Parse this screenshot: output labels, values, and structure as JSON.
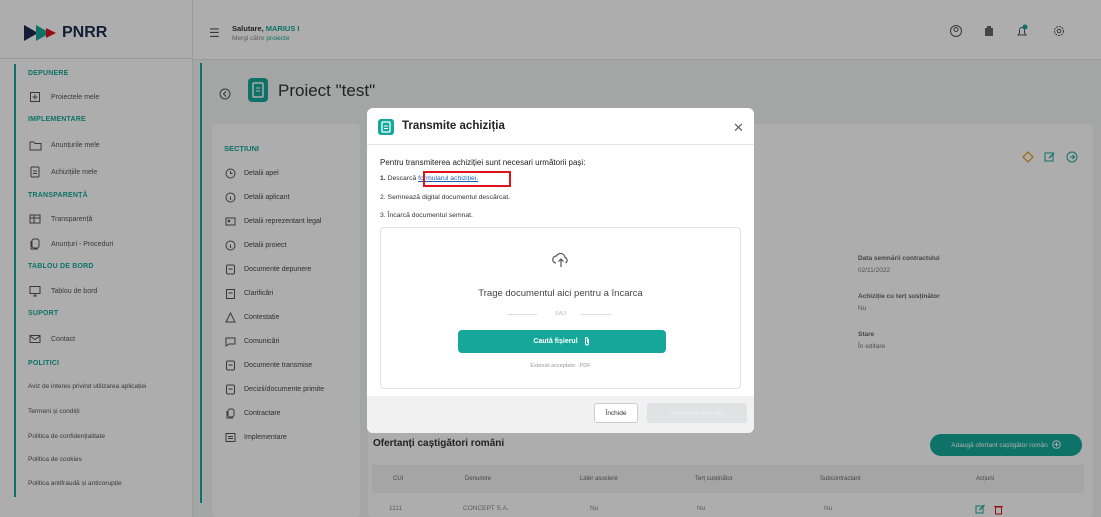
{
  "header": {
    "greeting_prefix": "Salutare, ",
    "user": "MARIUS I",
    "projects_prefix": "Mergi către ",
    "projects_link": "proiecte"
  },
  "logo": {
    "text": "PNRR"
  },
  "sidebar": {
    "sections": [
      "DEPUNERE",
      "IMPLEMENTARE",
      "TRANSPARENȚĂ",
      "TABLOU DE BORD",
      "SUPORT",
      "POLITICI"
    ],
    "items": [
      "Proiectele mele",
      "Anunțurile mele",
      "Achizițiile mele",
      "Transparență",
      "Anunțuri - Proceduri",
      "Tablou de bord",
      "Contact"
    ],
    "policies": [
      "Aviz de interes privind utilizarea aplicației",
      "Termeni și condiții",
      "Politica de confidențialitate",
      "Politica de cookies",
      "Politica antifraudă și anticorupție"
    ]
  },
  "project": {
    "title": "Proiect \"test\""
  },
  "sections_panel": {
    "title": "SECȚIUNI",
    "items": [
      "Detalii apel",
      "Detalii aplicant",
      "Detalii reprezentant legal",
      "Detalii proiect",
      "Documente depunere",
      "Clarificări",
      "Contestație",
      "Comunicări",
      "Documente transmise",
      "Decizii/documente primite",
      "Contractare",
      "Implementare"
    ]
  },
  "details": {
    "sign_date_label": "Data semnării contractului",
    "sign_date": "02/11/2022",
    "third_label": "Achiziție cu terț susținător",
    "third_value": "Nu",
    "state_label": "Stare",
    "state_value": "În editare"
  },
  "offers": {
    "title": "Ofertanți caștigători români",
    "add_button": "Adaugă ofertant caștigător român",
    "columns": [
      "CUI",
      "Denumire",
      "Lider asociere",
      "Terț susținător",
      "Subcontractant",
      "Acțiuni"
    ],
    "rows": [
      [
        "1111",
        "CONCEPT S.A.",
        "Nu",
        "Nu",
        "Nu"
      ]
    ]
  },
  "modal": {
    "title": "Transmite achiziția",
    "intro": "Pentru transmiterea achiziției sunt necesari următorii pași:",
    "step1_num": "1.",
    "step1_text": "Descarcă ",
    "step1_link": "formularul achiziției.",
    "step2": "2. Semnează digital documentul descărcat.",
    "step3": "3. Încarcă documentul semnat.",
    "drop_text": "Trage documentul aici pentru a încarca",
    "or_text": "SAU",
    "browse_button": "Caută fișierul",
    "extensions": "Extensii acceptate: .PDF",
    "close_button": "Închide",
    "send_button": "Transmite achiziția"
  },
  "colors": {
    "accent": "#15a89a",
    "danger": "#e0131c",
    "nav": "#1d2b4f"
  }
}
